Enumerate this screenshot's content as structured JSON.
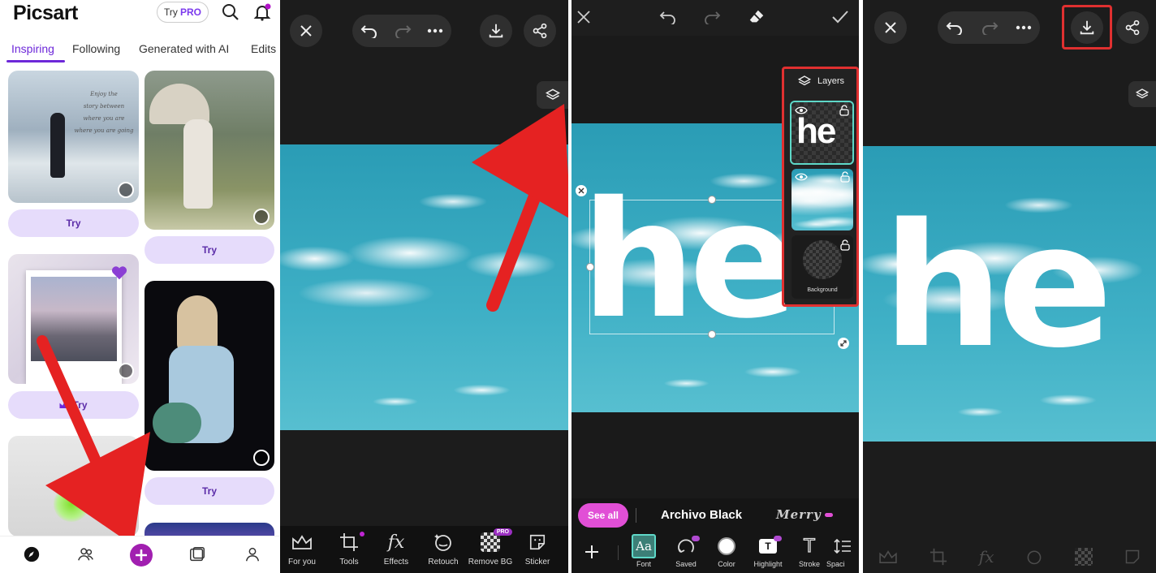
{
  "panel1": {
    "logo": "Picsart",
    "try_pro_label": "Try",
    "pro_badge": "PRO",
    "tabs": [
      "Inspiring",
      "Following",
      "Generated with AI",
      "Edits"
    ],
    "card_overlay_text": [
      "Enjoy the",
      "story between",
      "where you are",
      "where you are going"
    ],
    "try_label": "Try",
    "nav_icons": [
      "explore-icon",
      "people-icon",
      "create-icon",
      "folder-icon",
      "profile-icon"
    ],
    "accent": "#7c3aed",
    "create_color": "#a11fb0"
  },
  "panel2": {
    "toolbar": [
      "For you",
      "Tools",
      "Effects",
      "Retouch",
      "Remove BG",
      "Sticker"
    ],
    "pro_badge": "PRO"
  },
  "panel3": {
    "layers_title": "Layers",
    "layer_text": "he",
    "background_label": "Background",
    "canvas_text": "he",
    "see_all": "See all",
    "font_name": "Archivo Black",
    "font_name_2": "Merry",
    "tools": [
      "Font",
      "Saved",
      "Color",
      "Highlight",
      "Stroke",
      "Spaci"
    ],
    "font_glyph": "Aa",
    "stroke_glyph": "T",
    "highlight_badge": "T",
    "accent": "#e14fd6"
  },
  "panel4": {
    "canvas_text": "he",
    "highlight_color": "#e03030"
  }
}
